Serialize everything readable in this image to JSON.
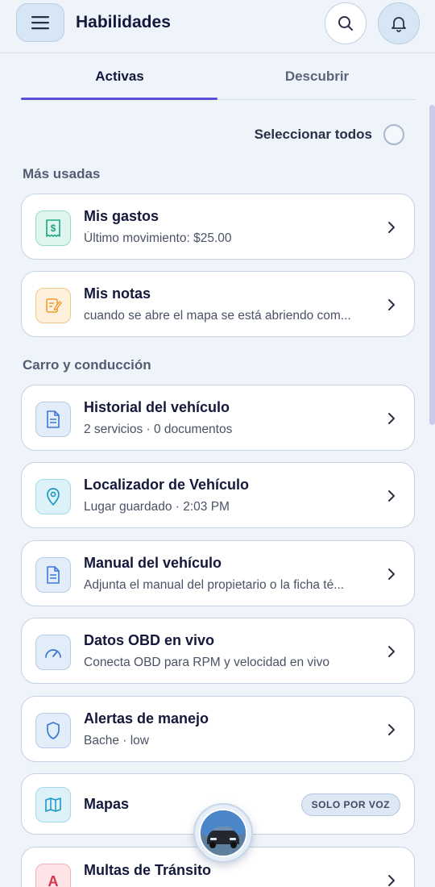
{
  "header": {
    "title": "Habilidades",
    "menu_icon": "hamburger-icon",
    "search_icon": "search-icon",
    "bell_icon": "bell-icon"
  },
  "tabs": [
    {
      "label": "Activas",
      "active": true
    },
    {
      "label": "Descubrir",
      "active": false
    }
  ],
  "select_all": {
    "label": "Seleccionar todos",
    "checked": false
  },
  "sections": [
    {
      "title": "Más usadas",
      "cards": [
        {
          "title": "Mis gastos",
          "subtitle": "Último movimiento: $25.00",
          "icon": "receipt-dollar-icon"
        },
        {
          "title": "Mis notas",
          "subtitle": "cuando se abre el mapa se está abriendo com...",
          "icon": "note-edit-icon"
        }
      ]
    },
    {
      "title": "Carro y conducción",
      "cards": [
        {
          "title": "Historial del vehículo",
          "subtitle": "2 servicios · 0 documentos",
          "icon": "document-icon"
        },
        {
          "title": "Localizador de Vehículo",
          "subtitle": "Lugar guardado · 2:03 PM",
          "icon": "location-pin-icon"
        },
        {
          "title": "Manual del vehículo",
          "subtitle": "Adjunta el manual del propietario o la ficha té...",
          "icon": "document-icon"
        },
        {
          "title": "Datos OBD en vivo",
          "subtitle": "Conecta OBD para RPM y velocidad en vivo",
          "icon": "speedometer-icon"
        },
        {
          "title": "Alertas de manejo",
          "subtitle": "Bache · low",
          "icon": "shield-icon"
        },
        {
          "title": "Mapas",
          "subtitle": "",
          "badge": "SOLO POR VOZ",
          "icon": "map-icon"
        },
        {
          "title": "Multas de Tránsito",
          "subtitle": "",
          "icon": "traffic-fine-icon",
          "icon_text": "A"
        }
      ]
    }
  ],
  "colors": {
    "accent": "#5a4fd6",
    "background": "#eff3fa",
    "card": "#ffffff"
  },
  "fab": {
    "icon": "car-avatar-icon"
  }
}
